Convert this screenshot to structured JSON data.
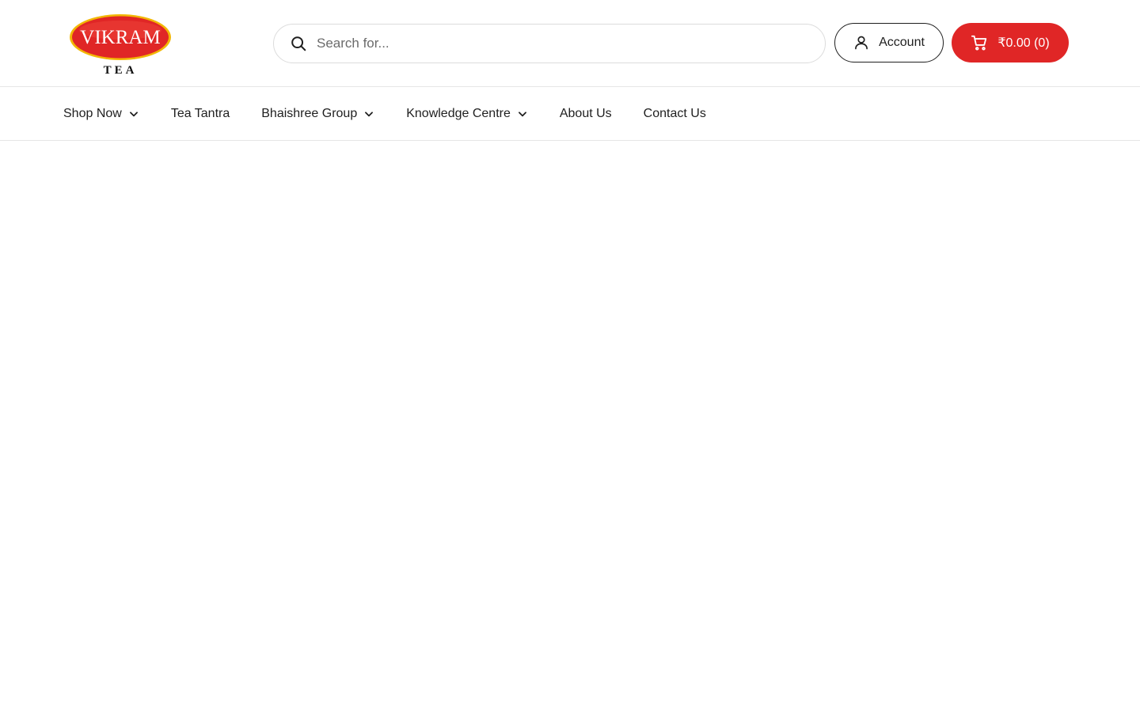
{
  "brand": {
    "logo_word": "VIKRAM",
    "logo_sub": "TEA",
    "colors": {
      "red": "#e02626",
      "gold": "#f2b705",
      "ink": "#1f1f1f"
    }
  },
  "search": {
    "placeholder": "Search for...",
    "value": "",
    "icon": "search-icon"
  },
  "account": {
    "label": "Account",
    "icon": "user-icon"
  },
  "cart": {
    "label": "₹0.00 (0)",
    "icon": "cart-icon"
  },
  "nav": {
    "items": [
      {
        "label": "Shop Now",
        "has_dropdown": true
      },
      {
        "label": "Tea Tantra",
        "has_dropdown": false
      },
      {
        "label": "Bhaishree Group",
        "has_dropdown": true
      },
      {
        "label": "Knowledge Centre",
        "has_dropdown": true
      },
      {
        "label": "About Us",
        "has_dropdown": false
      },
      {
        "label": "Contact Us",
        "has_dropdown": false
      }
    ]
  }
}
